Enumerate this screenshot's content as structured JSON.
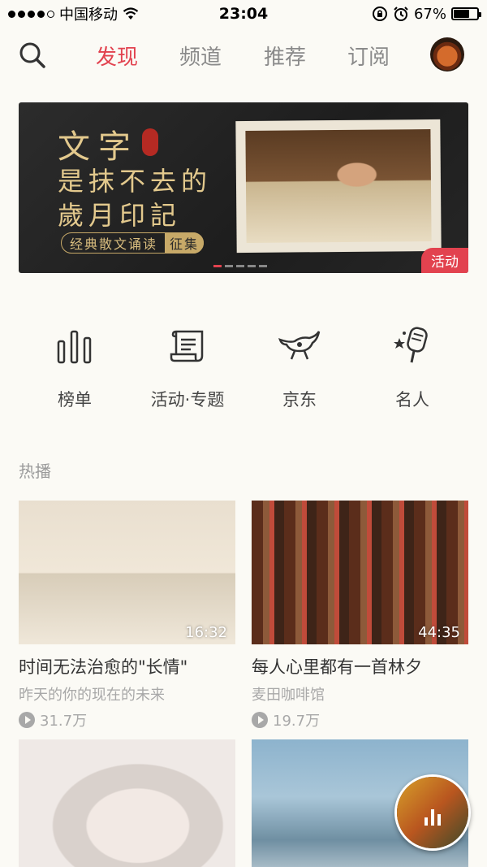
{
  "status_bar": {
    "carrier": "中国移动",
    "time": "23:04",
    "battery": "67%",
    "battery_level": 0.67,
    "signal_bars": 4
  },
  "nav": {
    "tabs": [
      {
        "label": "发现",
        "active": true
      },
      {
        "label": "频道",
        "active": false
      },
      {
        "label": "推荐",
        "active": false
      },
      {
        "label": "订阅",
        "active": false
      }
    ],
    "accent_color": "#e2424f"
  },
  "banner": {
    "line1": "文字",
    "line2": "是抹不去的",
    "line3": "歲月印記",
    "pill_text": "经典散文诵读",
    "pill_highlight": "征集",
    "tag": "活动",
    "slide_count": 5,
    "active_slide": 0
  },
  "quick_links": [
    {
      "label": "榜单",
      "icon": "chart-bars-icon"
    },
    {
      "label": "活动·专题",
      "icon": "scroll-icon"
    },
    {
      "label": "京东",
      "icon": "jd-dog-icon"
    },
    {
      "label": "名人",
      "icon": "microphone-star-icon"
    }
  ],
  "hot": {
    "section_title": "热播",
    "items": [
      {
        "title": "时间无法治愈的\"长情\"",
        "subtitle": "昨天的你的现在的未来",
        "plays": "31.7万",
        "duration": "16:32"
      },
      {
        "title": "每人心里都有一首林夕",
        "subtitle": "麦田咖啡馆",
        "plays": "19.7万",
        "duration": "44:35"
      },
      {
        "title": "",
        "subtitle": "",
        "plays": "",
        "duration": ""
      },
      {
        "title": "",
        "subtitle": "",
        "plays": "",
        "duration": ""
      }
    ]
  }
}
